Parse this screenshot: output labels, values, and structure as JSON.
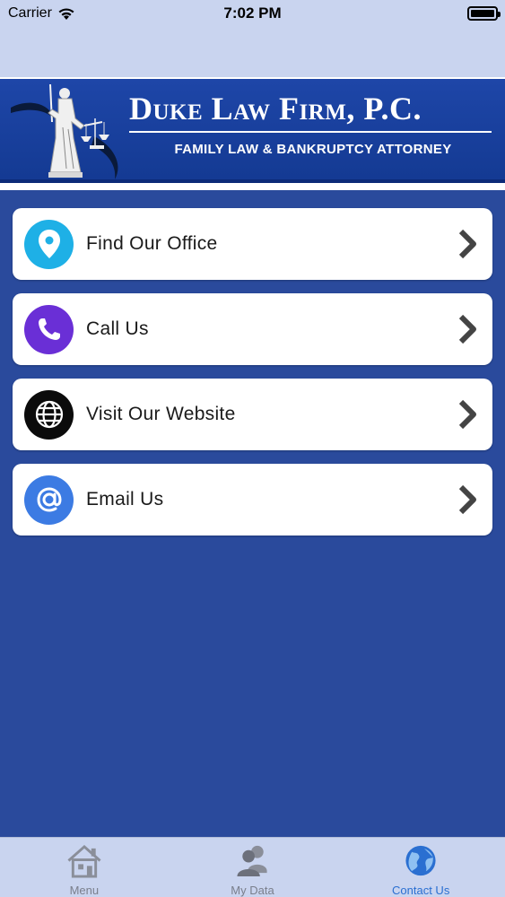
{
  "status_bar": {
    "carrier": "Carrier",
    "time": "7:02 PM"
  },
  "banner": {
    "firm_name": "Duke Law Firm, P.C.",
    "tagline": "FAMILY LAW & BANKRUPTCY ATTORNEY"
  },
  "menu": {
    "items": [
      {
        "label": "Find Our Office",
        "icon": "location-pin-icon",
        "color": "#1eb0e6"
      },
      {
        "label": "Call Us",
        "icon": "phone-icon",
        "color": "#6a2fd6"
      },
      {
        "label": "Visit Our Website",
        "icon": "globe-icon",
        "color": "#0b0b0b"
      },
      {
        "label": "Email Us",
        "icon": "at-sign-icon",
        "color": "#3c7be3"
      }
    ]
  },
  "tabs": [
    {
      "label": "Menu",
      "icon": "house-icon",
      "active": false
    },
    {
      "label": "My Data",
      "icon": "users-icon",
      "active": false
    },
    {
      "label": "Contact Us",
      "icon": "globe-icon",
      "active": true
    }
  ],
  "colors": {
    "background": "#2a4a9c",
    "banner": "#1c3f98",
    "bars": "#c9d4ef",
    "active_tab": "#2a6fd1"
  }
}
